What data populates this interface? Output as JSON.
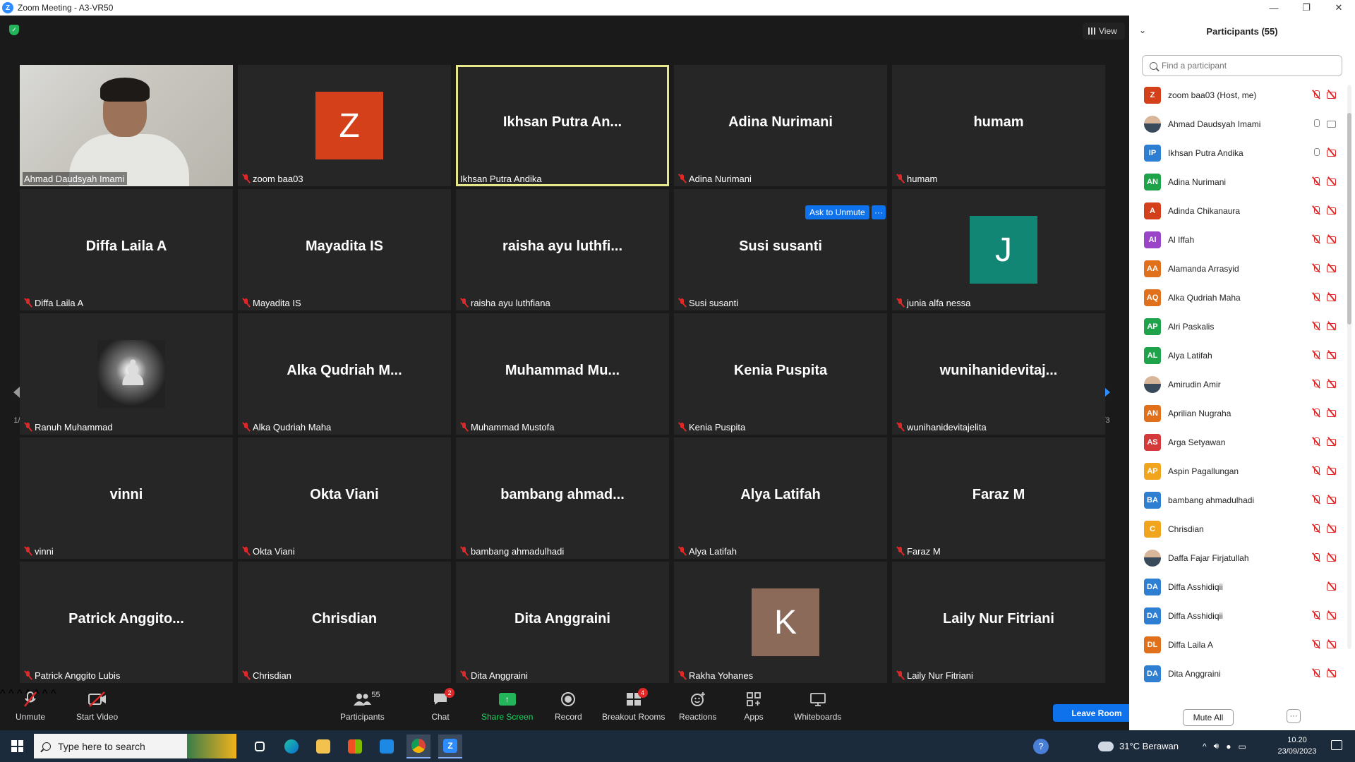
{
  "window": {
    "title": "Zoom Meeting - A3-VR50",
    "controls": [
      "—",
      "❐",
      "✕"
    ]
  },
  "meeting": {
    "view_label": "View"
  },
  "tiles": [
    {
      "name": "Ahmad Daudsyah Imami",
      "display": "",
      "muted": false,
      "video": true
    },
    {
      "name": "zoom baa03",
      "display": "",
      "avatar_letter": "Z",
      "avatar_color": "#d4401a",
      "muted": true
    },
    {
      "name": "Ikhsan Putra Andika",
      "display": "Ikhsan Putra An...",
      "muted": false,
      "speaking": true
    },
    {
      "name": "Adina Nurimani",
      "display": "Adina Nurimani",
      "muted": true
    },
    {
      "name": "humam",
      "display": "humam",
      "muted": true
    },
    {
      "name": "Diffa Laila A",
      "display": "Diffa Laila A",
      "muted": true
    },
    {
      "name": "Mayadita IS",
      "display": "Mayadita IS",
      "muted": true
    },
    {
      "name": "raisha ayu luthfiana",
      "display": "raisha ayu luthfi...",
      "muted": true
    },
    {
      "name": "Susi susanti",
      "display": "Susi susanti",
      "muted": true
    },
    {
      "name": "junia alfa nessa",
      "display": "",
      "avatar_letter": "J",
      "avatar_color": "#128675",
      "muted": true
    },
    {
      "name": "Ranuh Muhammad",
      "display": "",
      "chess": true,
      "muted": true
    },
    {
      "name": "Alka Qudriah Maha",
      "display": "Alka Qudriah M...",
      "muted": true
    },
    {
      "name": "Muhammad Mustofa",
      "display": "Muhammad  Mu...",
      "muted": true
    },
    {
      "name": "Kenia Puspita",
      "display": "Kenia Puspita",
      "muted": true
    },
    {
      "name": "wunihanidevitajelita",
      "display": "wunihanidevitaj...",
      "muted": true
    },
    {
      "name": "vinni",
      "display": "vinni",
      "muted": true
    },
    {
      "name": "Okta Viani",
      "display": "Okta Viani",
      "muted": true
    },
    {
      "name": "bambang ahmadulhadi",
      "display": "bambang  ahmad...",
      "muted": true
    },
    {
      "name": "Alya Latifah",
      "display": "Alya Latifah",
      "muted": true
    },
    {
      "name": "Faraz M",
      "display": "Faraz M",
      "muted": true
    },
    {
      "name": "Patrick Anggito Lubis",
      "display": "Patrick  Anggito...",
      "muted": true
    },
    {
      "name": "Chrisdian",
      "display": "Chrisdian",
      "muted": true
    },
    {
      "name": "Dita Anggraini",
      "display": "Dita Anggraini",
      "muted": true
    },
    {
      "name": "Rakha Yohanes",
      "display": "",
      "avatar_letter": "K",
      "avatar_color": "#8b6a5a",
      "muted": true
    },
    {
      "name": "Laily Nur Fitriani",
      "display": "Laily Nur Fitriani",
      "muted": true
    }
  ],
  "hover_actions": {
    "ask_to_unmute": "Ask to Unmute",
    "more": "···"
  },
  "pagination": {
    "prev": "1/3",
    "next": "1/3"
  },
  "toolbar": {
    "unmute": "Unmute",
    "start_video": "Start Video",
    "participants": "Participants",
    "participants_count": "55",
    "chat": "Chat",
    "chat_badge": "2",
    "share_screen": "Share Screen",
    "record": "Record",
    "breakout_rooms": "Breakout Rooms",
    "breakout_badge": "4",
    "reactions": "Reactions",
    "apps": "Apps",
    "whiteboards": "Whiteboards",
    "leave": "Leave Room"
  },
  "panel": {
    "title": "Participants (55)",
    "search_placeholder": "Find a participant",
    "mute_all": "Mute All",
    "more": "···",
    "participants": [
      {
        "initials": "Z",
        "color": "#d4401a",
        "name": "zoom baa03 (Host, me)",
        "mic": "off",
        "cam": "off"
      },
      {
        "initials": "",
        "color": "photo",
        "name": "Ahmad Daudsyah Imami",
        "mic": "on",
        "cam": "on"
      },
      {
        "initials": "IP",
        "color": "#2e7fd2",
        "name": "Ikhsan Putra Andika",
        "mic": "on",
        "cam": "off"
      },
      {
        "initials": "AN",
        "color": "#1fa34a",
        "name": "Adina Nurimani",
        "mic": "off",
        "cam": "off"
      },
      {
        "initials": "A",
        "color": "#d4401a",
        "name": "Adinda Chikanaura",
        "mic": "off",
        "cam": "off"
      },
      {
        "initials": "AI",
        "color": "#9a44c8",
        "name": "Al Iffah",
        "mic": "off",
        "cam": "off"
      },
      {
        "initials": "AA",
        "color": "#e0701b",
        "name": "Alamanda Arrasyid",
        "mic": "off",
        "cam": "off"
      },
      {
        "initials": "AQ",
        "color": "#e0701b",
        "name": "Alka Qudriah Maha",
        "mic": "off",
        "cam": "off"
      },
      {
        "initials": "AP",
        "color": "#1fa34a",
        "name": "Alri Paskalis",
        "mic": "off",
        "cam": "off"
      },
      {
        "initials": "AL",
        "color": "#1fa34a",
        "name": "Alya Latifah",
        "mic": "off",
        "cam": "off"
      },
      {
        "initials": "",
        "color": "photo",
        "name": "Amirudin Amir",
        "mic": "off",
        "cam": "off"
      },
      {
        "initials": "AN",
        "color": "#e0701b",
        "name": "Aprilian Nugraha",
        "mic": "off",
        "cam": "off"
      },
      {
        "initials": "AS",
        "color": "#d43a3a",
        "name": "Arga Setyawan",
        "mic": "off",
        "cam": "off"
      },
      {
        "initials": "AP",
        "color": "#f0a51d",
        "name": "Aspin Pagallungan",
        "mic": "off",
        "cam": "off"
      },
      {
        "initials": "BA",
        "color": "#2e7fd2",
        "name": "bambang ahmadulhadi",
        "mic": "off",
        "cam": "off"
      },
      {
        "initials": "C",
        "color": "#f0a51d",
        "name": "Chrisdian",
        "mic": "off",
        "cam": "off"
      },
      {
        "initials": "",
        "color": "photo",
        "name": "Daffa Fajar Firjatullah",
        "mic": "off",
        "cam": "off"
      },
      {
        "initials": "DA",
        "color": "#2e7fd2",
        "name": "Diffa Asshidiqii",
        "mic": "",
        "cam": "off"
      },
      {
        "initials": "DA",
        "color": "#2e7fd2",
        "name": "Diffa Asshidiqii",
        "mic": "off",
        "cam": "off"
      },
      {
        "initials": "DL",
        "color": "#e0701b",
        "name": "Diffa Laila A",
        "mic": "off",
        "cam": "off"
      },
      {
        "initials": "DA",
        "color": "#2e7fd2",
        "name": "Dita Anggraini",
        "mic": "off",
        "cam": "off"
      }
    ]
  },
  "taskbar": {
    "search_placeholder": "Type here to search",
    "weather": "31°C  Berawan",
    "time": "10.20",
    "date": "23/09/2023"
  }
}
